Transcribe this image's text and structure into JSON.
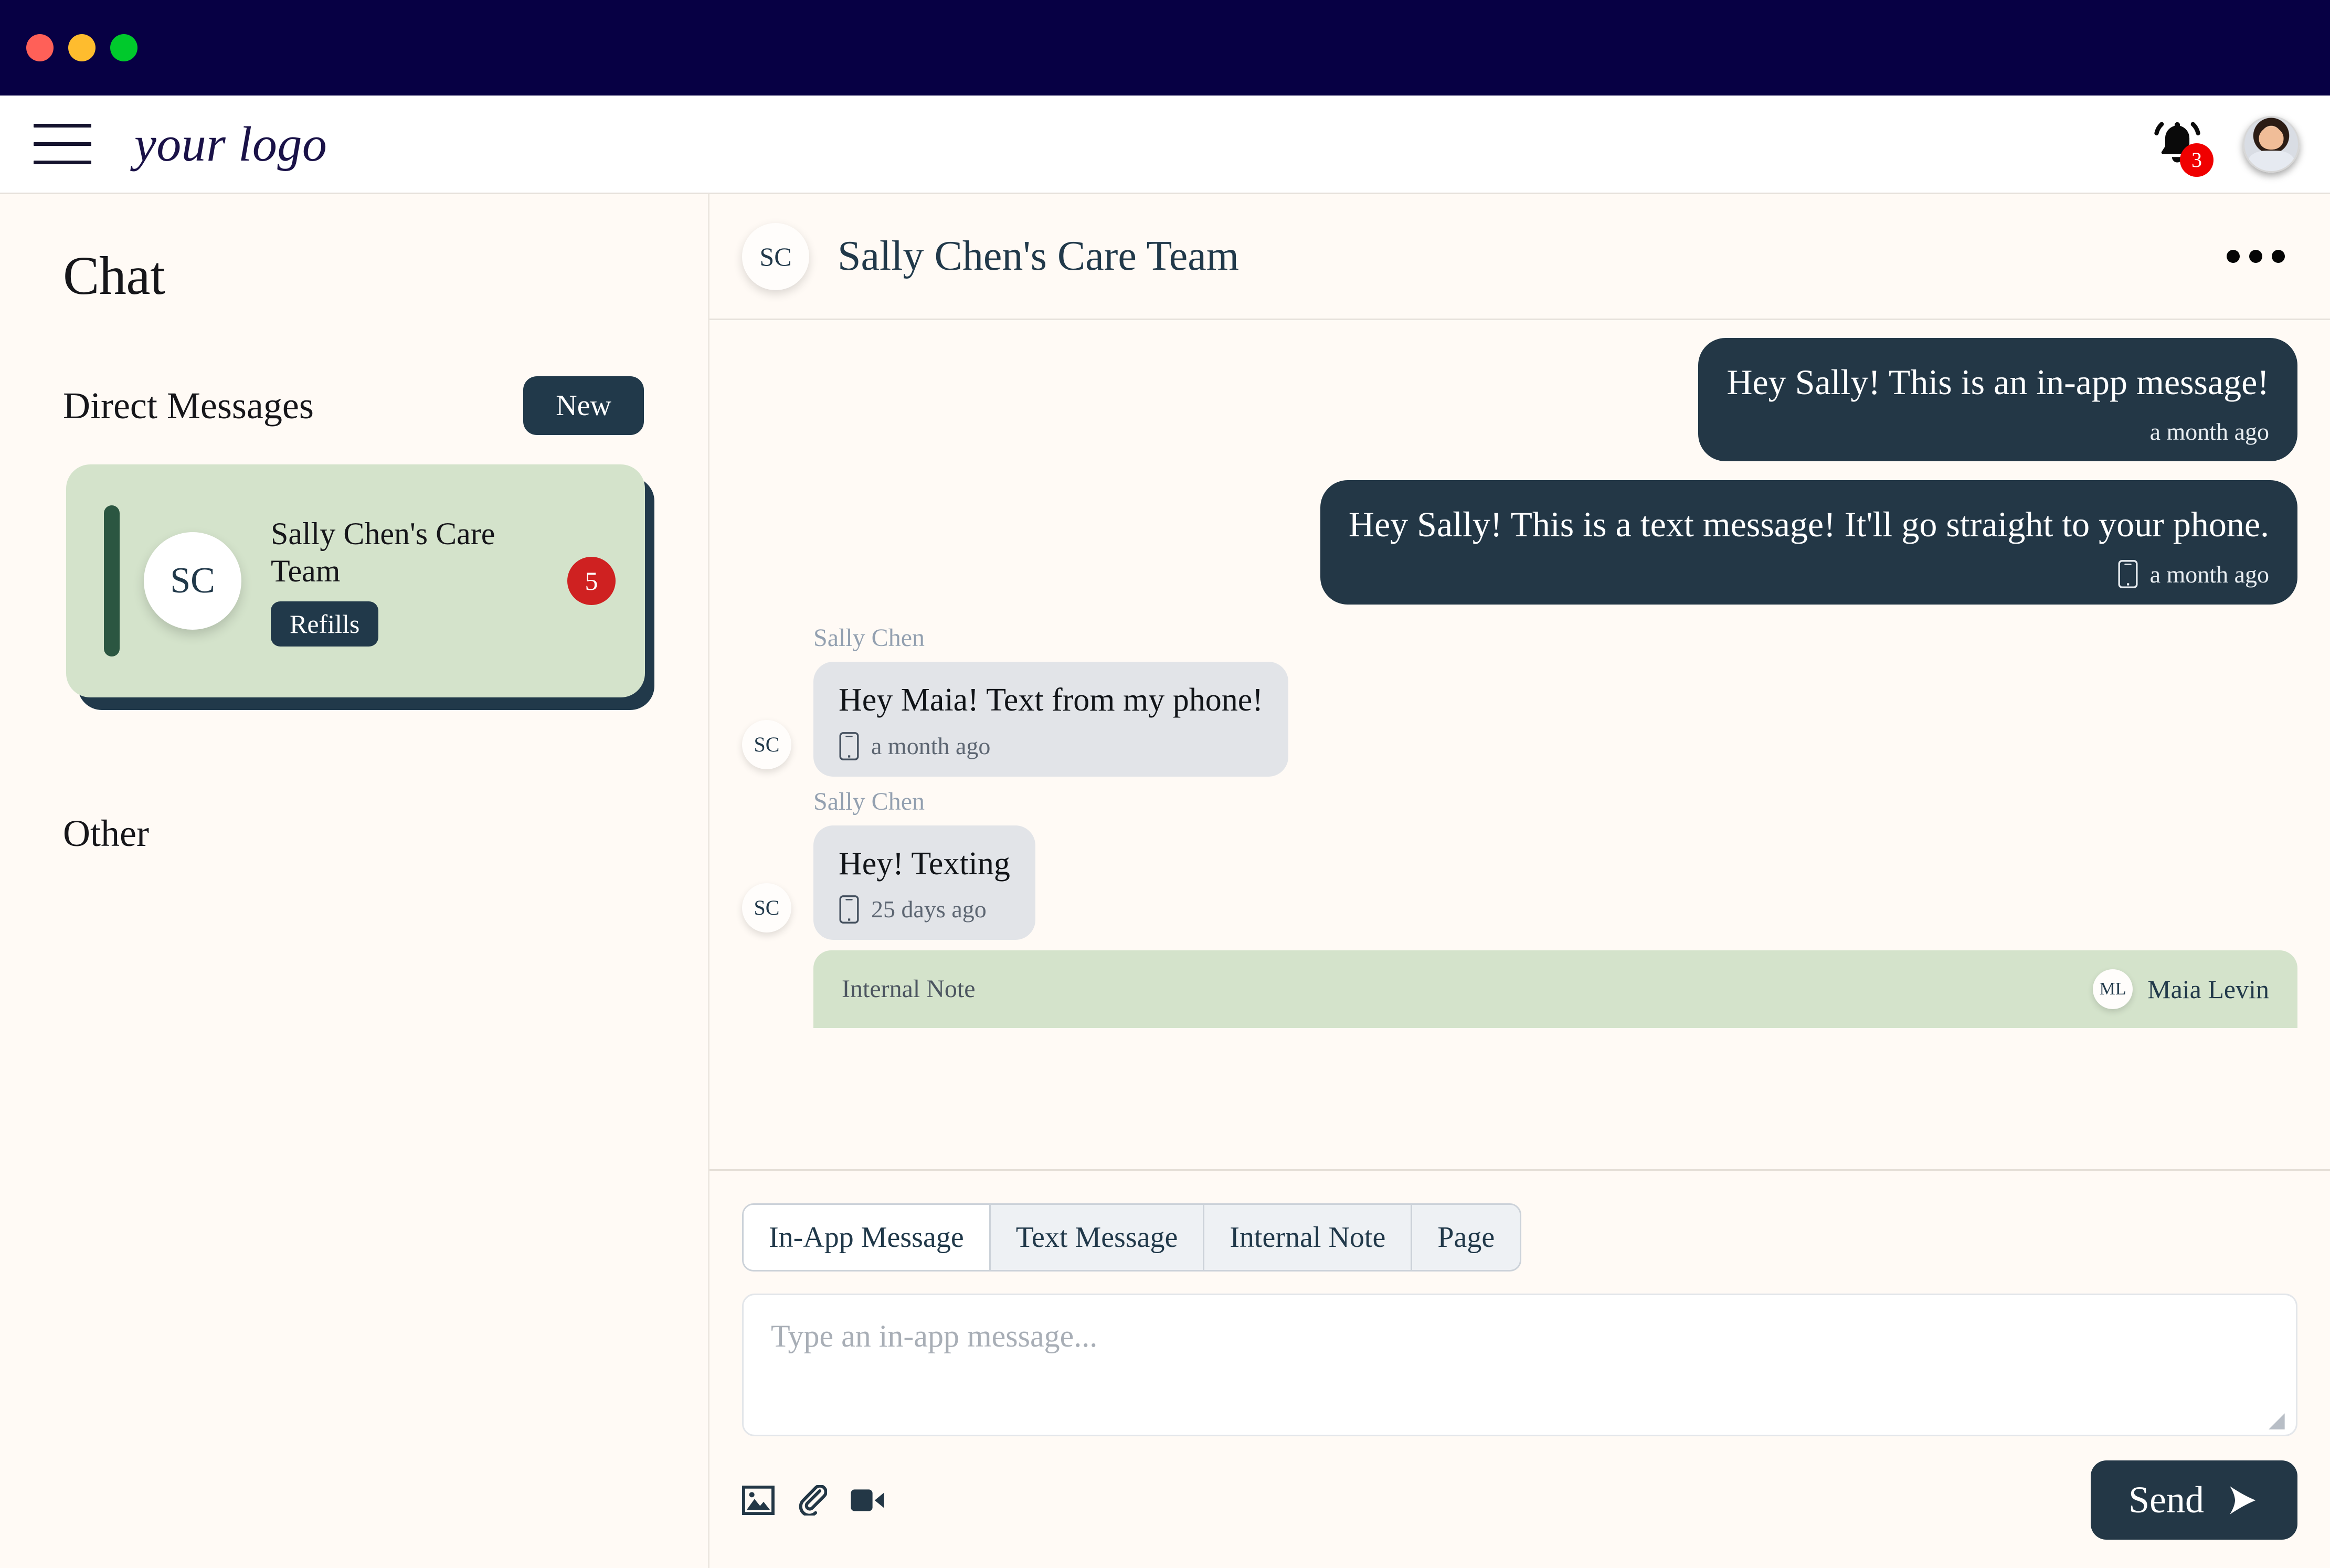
{
  "window": {
    "traffic_lights": [
      "close",
      "minimize",
      "maximize"
    ]
  },
  "header": {
    "menu_icon": "hamburger-icon",
    "logo_text": "your logo",
    "notification_icon": "bell-icon",
    "notification_count": "3",
    "avatar_icon": "user-avatar"
  },
  "sidebar": {
    "title": "Chat",
    "direct_messages_label": "Direct Messages",
    "new_button": "New",
    "other_label": "Other",
    "conversations": [
      {
        "initials": "SC",
        "name": "Sally Chen's Care Team",
        "tag": "Refills",
        "unread": "5",
        "selected": true
      }
    ]
  },
  "chat": {
    "header": {
      "initials": "SC",
      "title": "Sally Chen's Care Team",
      "menu_icon": "more-options-icon"
    },
    "messages": [
      {
        "direction": "outgoing",
        "text": "Hey Sally! This is an in-app message!",
        "timestamp": "a month ago",
        "channel_icon": null
      },
      {
        "direction": "outgoing",
        "text": "Hey Sally! This is a text message! It'll go straight to your phone.",
        "timestamp": "a month ago",
        "channel_icon": "mobile-phone-icon"
      },
      {
        "direction": "incoming",
        "sender": "Sally Chen",
        "initials": "SC",
        "text": "Hey Maia! Text from my phone!",
        "timestamp": "a month ago",
        "channel_icon": "mobile-phone-icon"
      },
      {
        "direction": "incoming",
        "sender": "Sally Chen",
        "initials": "SC",
        "text": "Hey! Texting",
        "timestamp": "25 days ago",
        "channel_icon": "mobile-phone-icon"
      }
    ],
    "internal_note": {
      "label": "Internal Note",
      "author_initials": "ML",
      "author_name": "Maia Levin"
    }
  },
  "composer": {
    "tabs": [
      {
        "label": "In-App Message",
        "active": true
      },
      {
        "label": "Text Message",
        "active": false
      },
      {
        "label": "Internal Note",
        "active": false
      },
      {
        "label": "Page",
        "active": false
      }
    ],
    "input_placeholder": "Type an in-app message...",
    "input_value": "",
    "tool_icons": [
      "image-icon",
      "paperclip-icon",
      "video-camera-icon"
    ],
    "send_label": "Send",
    "send_icon": "send-arrow-icon"
  },
  "colors": {
    "titlebar": "#070044",
    "accent_dark": "#233746",
    "accent_green": "#d4e3cb",
    "accent_green_bar": "#2b5641",
    "badge_red": "#cf2121",
    "notification_red": "#f00000",
    "background": "#fffaf5",
    "bubble_in": "#e2e4e8"
  }
}
